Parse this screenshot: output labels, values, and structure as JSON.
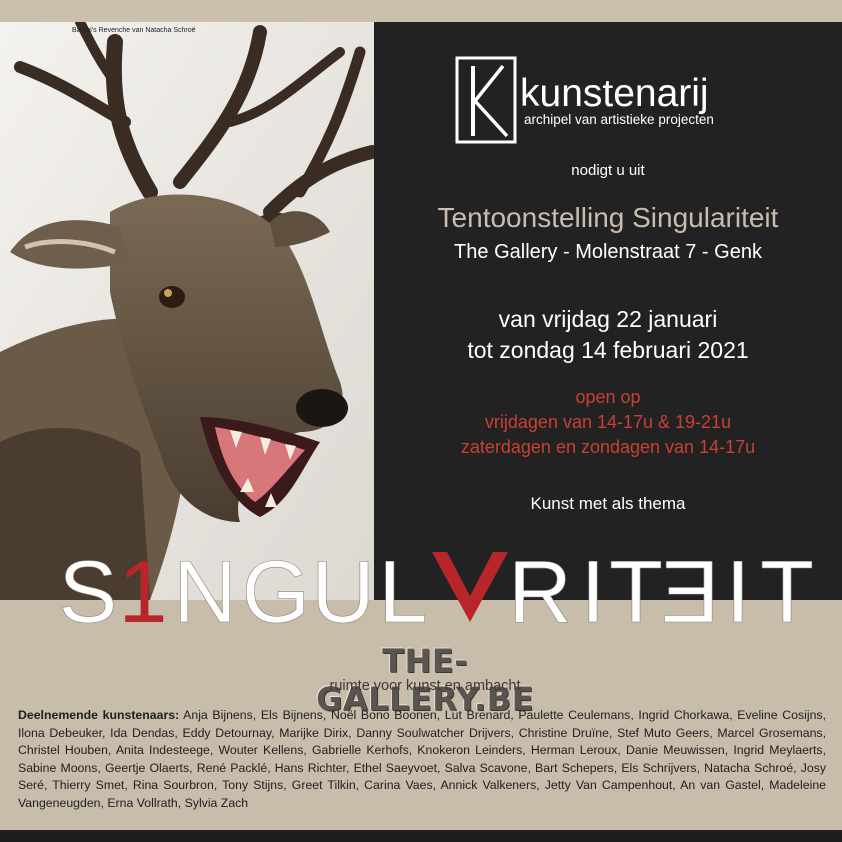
{
  "caption": "Bambi's Revenche van Natacha Schroë",
  "brand": {
    "name": "kunstenarij",
    "subtitle": "archipel van artistieke projecten",
    "logo_icon": "k-logo-icon"
  },
  "invite": "nodigt u uit",
  "exhibition": {
    "title": "Tentoonstelling Singulariteit",
    "venue": "The Gallery - Molenstraat 7 - Genk",
    "date_line1": "van vrijdag 22 januari",
    "date_line2": "tot zondag 14 februari 2021",
    "open_line1": "open op",
    "open_line2": "vrijdagen van 14-17u & 19-21u",
    "open_line3": "zaterdagen en zondagen van 14-17u",
    "theme": "Kunst met als thema"
  },
  "big_word": {
    "letters": [
      "S",
      "1",
      "N",
      "G",
      "U",
      "L",
      "A",
      "R",
      "I",
      "T",
      "Ǝ",
      "I",
      "T"
    ],
    "white_color": "#ffffff",
    "red_color": "#b8262a"
  },
  "website": {
    "url": "THE-GALLERY.BE",
    "tagline": "ruimte voor kunst en ambacht"
  },
  "artists": {
    "label": "Deelnemende kunstenaars:",
    "names": "Anja Bijnens, Els Bijnens, Noël Bono Boonen, Lut Brenard, Paulette Ceulemans, Ingrid Chorkawa, Eveline Cosijns, Ilona Debeuker, Ida Dendas, Eddy Detournay, Marijke Dirix, Danny Soulwatcher Drijvers, Christine Druïne, Stef Muto Geers, Marcel Grosemans, Christel Houben, Anita Indesteege, Wouter Kellens, Gabrielle Kerhofs, Knokeron Leinders, Herman Leroux, Danie  Meuwissen, Ingrid Meylaerts, Sabine Moons, Geertje Olaerts, René Packlé, Hans Richter, Ethel Saeyvoet, Salva Scavone, Bart Schepers, Els Schrijvers, Natacha Schroé, Josy  Seré, Thierry Smet, Rina Sourbron, Tony  Stijns, Greet Tilkin, Carina Vaes, Annick Valkeners, Jetty Van Campenhout, An van Gastel, Madeleine Vangeneugden, Erna Vollrath, Sylvia Zach"
  },
  "colors": {
    "panel": "#222222",
    "tan": "#c8bcab",
    "accent_red": "#c94034"
  }
}
